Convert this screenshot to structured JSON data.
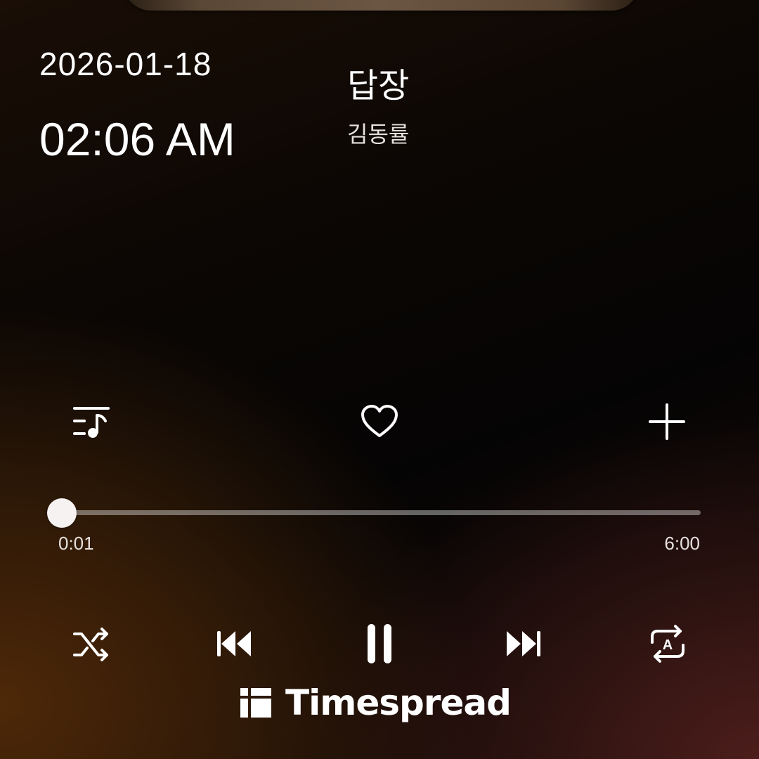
{
  "status": {
    "date": "2026-01-18",
    "time": "02:06 AM"
  },
  "track": {
    "title": "답장",
    "artist": "김동률"
  },
  "actions": {
    "playlist_icon": "playlist-music-icon",
    "like_icon": "heart-outline-icon",
    "add_icon": "plus-icon"
  },
  "progress": {
    "elapsed": "0:01",
    "duration": "6:00",
    "fraction": 0.003
  },
  "controls": {
    "shuffle_icon": "shuffle-icon",
    "previous_icon": "skip-previous-icon",
    "play_state_icon": "pause-icon",
    "next_icon": "skip-next-icon",
    "repeat_icon": "repeat-a-icon",
    "repeat_badge": "A"
  },
  "branding": {
    "logo_icon": "timespread-logo-icon",
    "name": "Timespread"
  },
  "colors": {
    "foreground": "#ffffff",
    "secondary_text": "#e6e1dc",
    "track_inactive": "rgba(255,255,255,0.38)"
  }
}
